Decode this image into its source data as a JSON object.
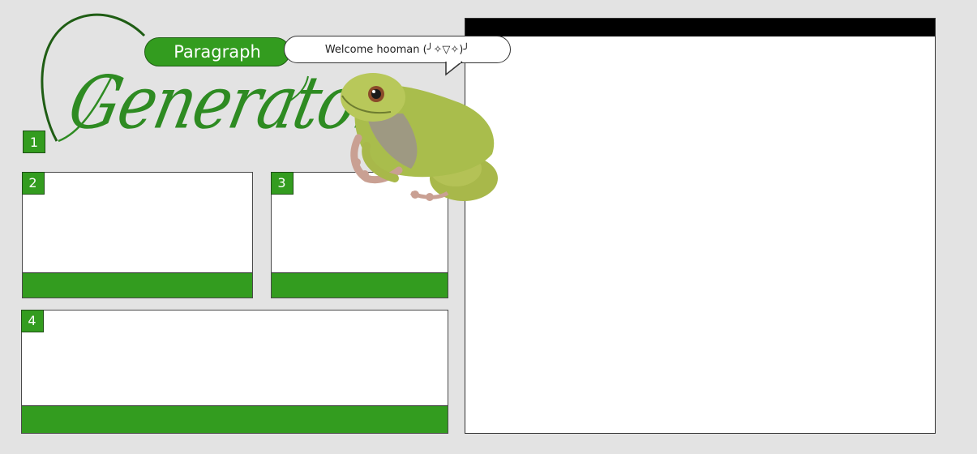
{
  "logo": {
    "badge_text": "Paragraph",
    "script_text": "Generator"
  },
  "speech_bubble": {
    "text": "Welcome hooman (╯✧▽✧)╯"
  },
  "steps": [
    {
      "number": "1"
    },
    {
      "number": "2"
    },
    {
      "number": "3"
    },
    {
      "number": "4"
    }
  ],
  "colors": {
    "background": "#e3e3e3",
    "accent_green": "#339c1f",
    "dark_green": "#1f5d14",
    "output_header": "#000000",
    "panel": "#ffffff"
  },
  "decoration": {
    "mascot": "green-tree-frog"
  }
}
